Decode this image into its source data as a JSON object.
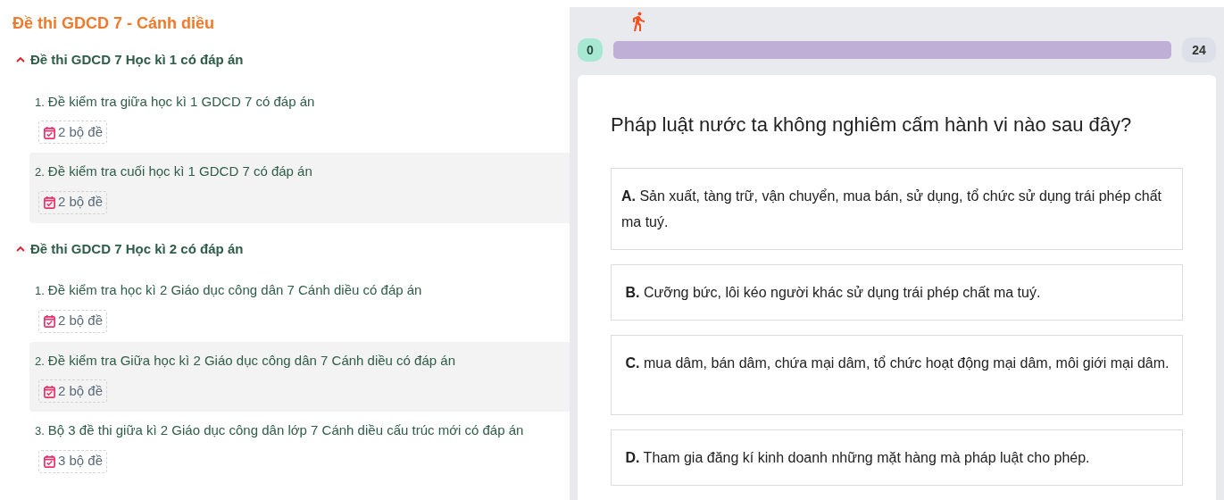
{
  "sidebar": {
    "title": "Đề thi GDCD 7 - Cánh diều",
    "groups": [
      {
        "title": "Đề thi GDCD 7 Học kì 1 có đáp án",
        "expanded": true,
        "items": [
          {
            "number": "1.",
            "title": "Đề kiểm tra giữa học kì 1 GDCD 7 có đáp án",
            "count": "2 bộ đề",
            "highlighted": false
          },
          {
            "number": "2.",
            "title": "Đề kiểm tra cuối học kì 1 GDCD 7 có đáp án",
            "count": "2 bộ đề",
            "highlighted": true
          }
        ]
      },
      {
        "title": "Đề thi GDCD 7 Học kì 2 có đáp án",
        "expanded": true,
        "items": [
          {
            "number": "1.",
            "title": "Đề kiểm tra học kì 2 Giáo dục công dân 7 Cánh diều có đáp án",
            "count": "2 bộ đề",
            "highlighted": false
          },
          {
            "number": "2.",
            "title": "Đề kiểm tra Giữa học kì 2 Giáo dục công dân 7 Cánh diều có đáp án",
            "count": "2 bộ đề",
            "highlighted": true
          },
          {
            "number": "3.",
            "title": "Bộ 3 đề thi giữa kì 2 Giáo dục công dân lớp 7 Cánh diều cấu trúc mới có đáp án",
            "count": "3 bộ đề",
            "highlighted": false
          }
        ]
      }
    ]
  },
  "quiz": {
    "progress": {
      "start": "0",
      "end": "24",
      "level": 0
    },
    "question": "Pháp luật nước ta không nghiêm cấm hành vi nào sau đây?",
    "options": [
      {
        "text": "**A.** Sản xuất, tàng trữ, vận chuyển, mua bán, sử dụng, tổ chức sử dụng trái phép chất ma tuý."
      },
      {
        "text": " **B.** Cưỡng bức, lôi kéo người khác sử dụng trái phép chất ma tuý."
      },
      {
        "text": " **C.** mua dâm, bán dâm, chứa mại dâm, tổ chức hoạt động mại dâm, môi giới mại dâm."
      },
      {
        "text": " **D.** Tham gia đăng kí kinh doanh những mặt hàng mà pháp luật cho phép."
      }
    ]
  }
}
